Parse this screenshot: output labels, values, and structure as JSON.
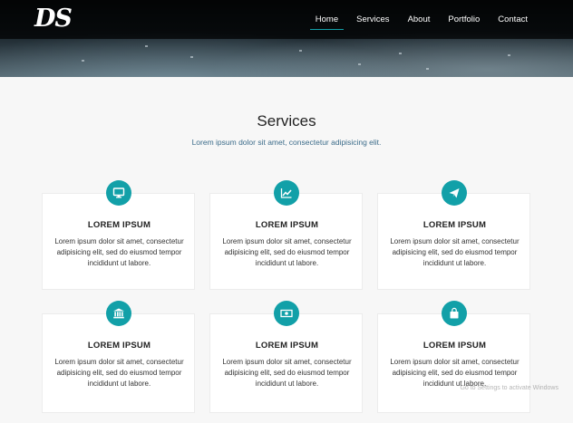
{
  "brand": {
    "logo": "DS"
  },
  "nav": {
    "items": [
      {
        "label": "Home",
        "active": true
      },
      {
        "label": "Services",
        "active": false
      },
      {
        "label": "About",
        "active": false
      },
      {
        "label": "Portfolio",
        "active": false
      },
      {
        "label": "Contact",
        "active": false
      }
    ]
  },
  "section": {
    "title": "Services",
    "subtitle": "Lorem ipsum dolor sit amet, consectetur adipisicing elit."
  },
  "cards": [
    {
      "icon": "monitor-icon",
      "title": "LOREM IPSUM",
      "text": "Lorem ipsum dolor sit amet, consectetur adipisicing elit, sed do eiusmod tempor incididunt ut labore."
    },
    {
      "icon": "line-chart-icon",
      "title": "LOREM IPSUM",
      "text": "Lorem ipsum dolor sit amet, consectetur adipisicing elit, sed do eiusmod tempor incididunt ut labore."
    },
    {
      "icon": "paper-plane-icon",
      "title": "LOREM IPSUM",
      "text": "Lorem ipsum dolor sit amet, consectetur adipisicing elit, sed do eiusmod tempor incididunt ut labore."
    },
    {
      "icon": "bank-icon",
      "title": "LOREM IPSUM",
      "text": "Lorem ipsum dolor sit amet, consectetur adipisicing elit, sed do eiusmod tempor incididunt ut labore."
    },
    {
      "icon": "money-icon",
      "title": "LOREM IPSUM",
      "text": "Lorem ipsum dolor sit amet, consectetur adipisicing elit, sed do eiusmod tempor incididunt ut labore."
    },
    {
      "icon": "shopping-bag-icon",
      "title": "LOREM IPSUM",
      "text": "Lorem ipsum dolor sit amet, consectetur adipisicing elit, sed do eiusmod tempor incididunt ut labore."
    }
  ],
  "watermark": "Go to Settings to activate Windows",
  "colors": {
    "accent": "#12a0a8",
    "background": "#f7f7f7",
    "card": "#ffffff"
  }
}
